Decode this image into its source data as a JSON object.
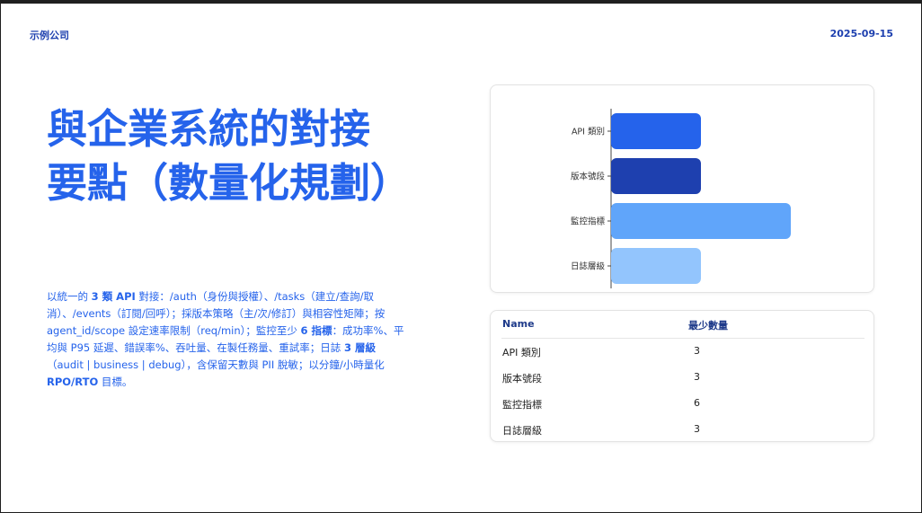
{
  "header": {
    "company": "示例公司",
    "date": "2025-09-15"
  },
  "title": "與企業系統的對接要點（數量化規劃）",
  "description": {
    "p1": "以統一的 ",
    "b1": "3 類 API",
    "p2": " 對接：/auth（身份與授權）、/tasks（建立/查詢/取消）、/events（訂閱/回呼）；採版本策略（主/次/修訂）與相容性矩陣；按 agent_id/scope 設定速率限制（req/min）；監控至少 ",
    "b2": "6 指標",
    "p3": "：成功率%、平均與 P95 延遲、錯誤率%、吞吐量、在製任務量、重試率；日誌 ",
    "b3": "3 層級",
    "p4": "（audit | business | debug），含保留天數與 PII 脫敏；以分鐘/小時量化 ",
    "b4": "RPO/RTO",
    "p5": " 目標。"
  },
  "chart_data": {
    "type": "bar",
    "orientation": "horizontal",
    "categories": [
      "API 類別",
      "版本號段",
      "監控指標",
      "日誌層級"
    ],
    "values": [
      3,
      3,
      6,
      3
    ],
    "colors": [
      "#2563eb",
      "#1e40af",
      "#60a5fa",
      "#93c5fd"
    ],
    "xlim": [
      0,
      6
    ],
    "grid": false,
    "title": "",
    "xlabel": "",
    "ylabel": ""
  },
  "table": {
    "headers": [
      "Name",
      "最少數量"
    ],
    "rows": [
      [
        "API 類別",
        "3"
      ],
      [
        "版本號段",
        "3"
      ],
      [
        "監控指標",
        "6"
      ],
      [
        "日誌層級",
        "3"
      ]
    ]
  }
}
